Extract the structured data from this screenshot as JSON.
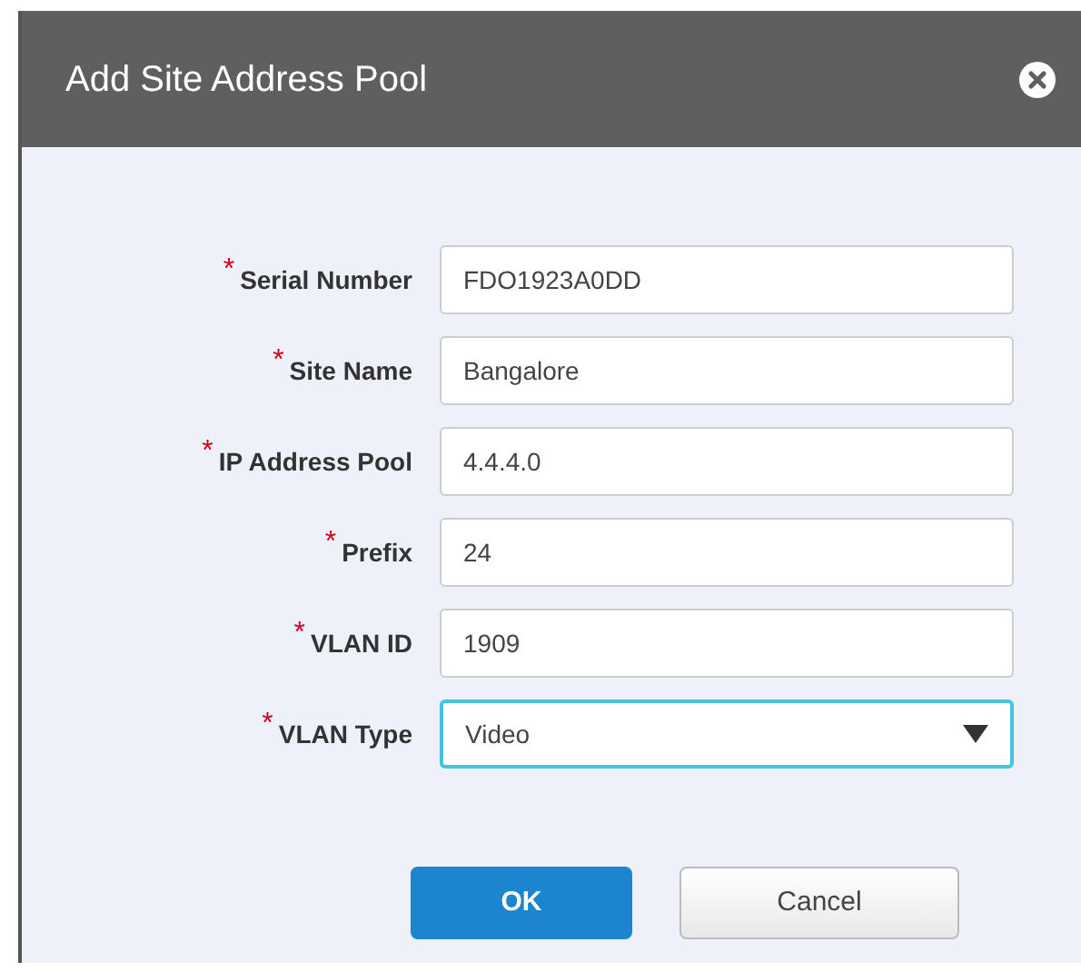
{
  "dialog": {
    "title": "Add Site Address Pool"
  },
  "fields": [
    {
      "label": "Serial Number",
      "mark": "*",
      "value": "FDO1923A0DD",
      "kind": "text",
      "focused": false
    },
    {
      "label": "Site Name",
      "mark": "*",
      "value": "Bangalore",
      "kind": "text",
      "focused": false
    },
    {
      "label": "IP Address Pool",
      "mark": "*",
      "value": "4.4.4.0",
      "kind": "text",
      "focused": false
    },
    {
      "label": "Prefix",
      "mark": "*",
      "value": "24",
      "kind": "text",
      "focused": false
    },
    {
      "label": "VLAN ID",
      "mark": "*",
      "value": "1909",
      "kind": "text",
      "focused": false
    },
    {
      "label": "VLAN Type",
      "mark": "*",
      "value": "Video",
      "kind": "select",
      "focused": true
    }
  ],
  "buttons": [
    {
      "label": "OK",
      "kind": "primary"
    },
    {
      "label": "Cancel",
      "kind": "secondary"
    }
  ]
}
